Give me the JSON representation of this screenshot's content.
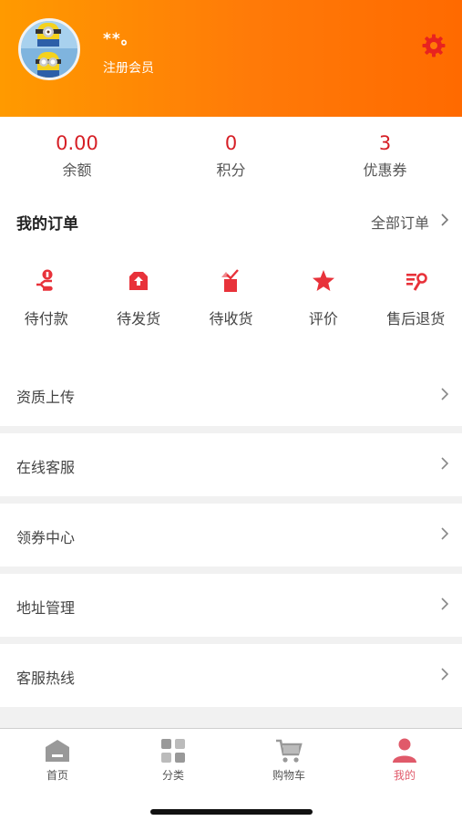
{
  "profile": {
    "nickname": "**。",
    "member_level": "注册会员"
  },
  "stats": [
    {
      "value": "0.00",
      "label": "余额"
    },
    {
      "value": "0",
      "label": "积分"
    },
    {
      "value": "3",
      "label": "优惠券"
    }
  ],
  "orders": {
    "title": "我的订单",
    "all_label": "全部订单",
    "items": [
      {
        "label": "待付款",
        "icon": "payment-pending-icon"
      },
      {
        "label": "待发货",
        "icon": "to-ship-icon"
      },
      {
        "label": "待收货",
        "icon": "to-receive-icon"
      },
      {
        "label": "评价",
        "icon": "star-icon"
      },
      {
        "label": "售后退货",
        "icon": "after-sales-icon"
      }
    ]
  },
  "menu": [
    {
      "label": "资质上传"
    },
    {
      "label": "在线客服"
    },
    {
      "label": "领券中心"
    },
    {
      "label": "地址管理"
    },
    {
      "label": "客服热线"
    }
  ],
  "tabbar": [
    {
      "label": "首页",
      "icon": "home-icon"
    },
    {
      "label": "分类",
      "icon": "category-icon"
    },
    {
      "label": "购物车",
      "icon": "cart-icon"
    },
    {
      "label": "我的",
      "icon": "profile-icon",
      "active": true
    }
  ],
  "colors": {
    "accent": "#d61f26",
    "header_start": "#ff9a00",
    "header_end": "#ff6a00",
    "tab_active": "#e05a6a"
  }
}
